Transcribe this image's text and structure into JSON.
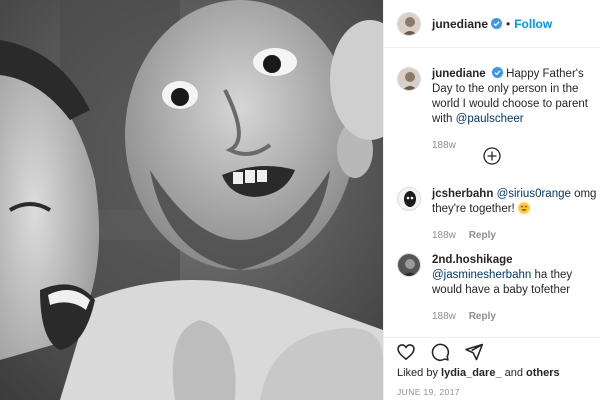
{
  "header": {
    "username": "junediane",
    "separator": "•",
    "follow_label": "Follow"
  },
  "caption": {
    "username": "junediane",
    "text": "Happy Father's Day to the only person in the world I would choose to parent with ",
    "mention": "@paulscheer",
    "age": "188w"
  },
  "comments": [
    {
      "username": "jcsherbahn",
      "mention": "@sirius0range",
      "text": " omg they're together! ",
      "age": "188w",
      "reply_label": "Reply"
    },
    {
      "username": "2nd.hoshikage",
      "mention": "@jasminesherbahn",
      "text": " ha they would have a baby tofether",
      "age": "188w",
      "reply_label": "Reply"
    }
  ],
  "likes": {
    "prefix": "Liked by ",
    "user": "lydia_dare_",
    "conjunction": " and ",
    "others": "others"
  },
  "date": "JUNE 19, 2017",
  "icons": {
    "like": "heart-icon",
    "comment": "comment-icon",
    "share": "paper-plane-icon",
    "load_more": "plus-circle-icon",
    "verified": "verified-badge-icon"
  },
  "colors": {
    "link": "#0095f6",
    "mention": "#00376b",
    "verified": "#3897f0",
    "muted": "#8e8e8e"
  }
}
